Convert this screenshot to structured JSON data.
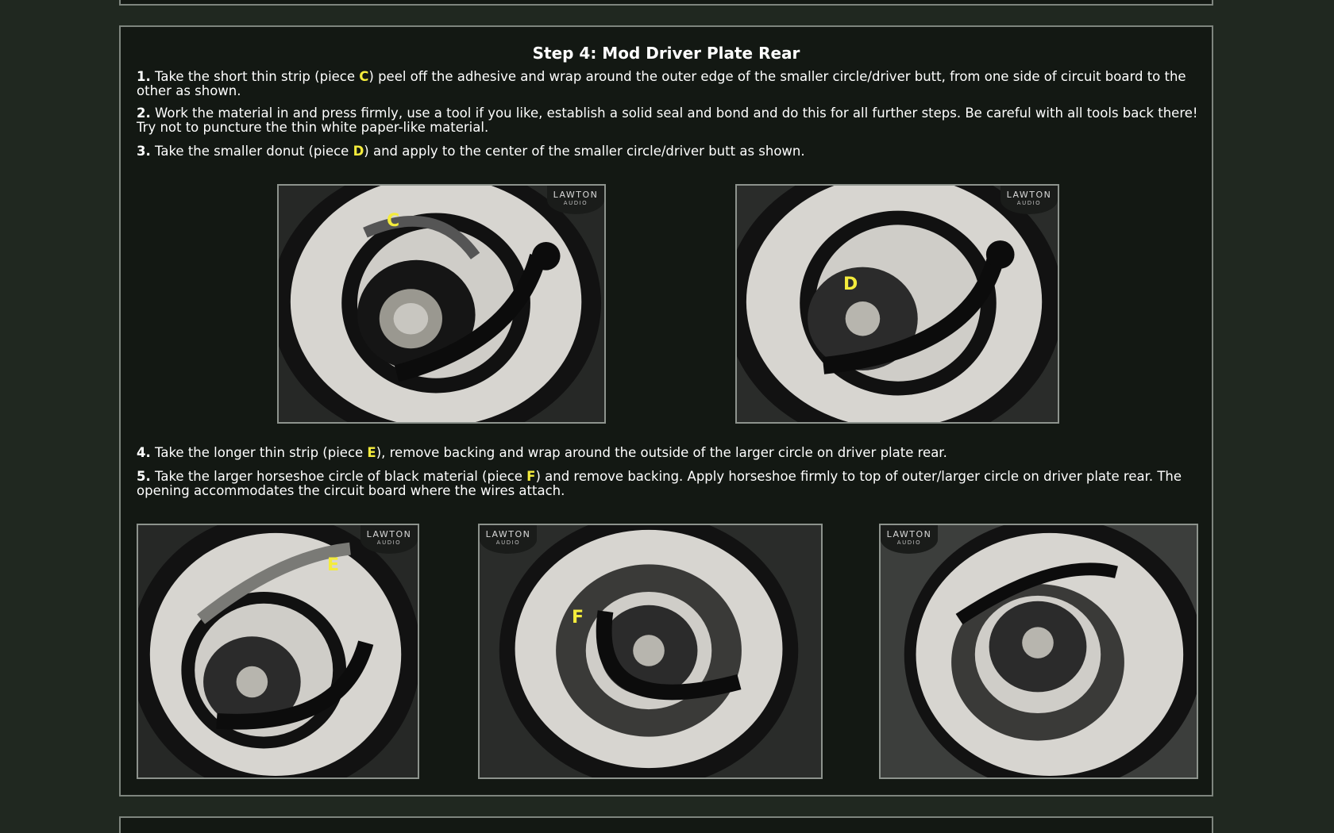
{
  "step": {
    "title": "Step 4: Mod Driver Plate Rear"
  },
  "instructions": [
    {
      "number": "1.",
      "before": " Take the short thin strip (piece ",
      "piece": "C",
      "after": ") peel off the adhesive and wrap around the outer edge of the smaller circle/driver butt, from one side of circuit board to the other as shown."
    },
    {
      "number": "2.",
      "text": " Work the material in and press firmly, use a tool if you like, establish a solid seal and bond and do this for all further steps. Be careful with all tools back there! Try not to puncture the thin white paper-like material."
    },
    {
      "number": "3.",
      "before": " Take the smaller donut (piece ",
      "piece": "D",
      "after": ") and apply to the center of the smaller circle/driver butt as shown."
    },
    {
      "number": "4.",
      "before": " Take the longer thin strip (piece ",
      "piece": "E",
      "after": "), remove backing and wrap around the outside of the larger circle on driver plate rear."
    },
    {
      "number": "5.",
      "before": " Take the larger horseshoe circle of black material (piece ",
      "piece": "F",
      "after": ") and remove backing. Apply horseshoe firmly to top of outer/larger circle on driver plate rear. The opening accommodates the circuit board where the wires attach."
    }
  ],
  "logo": {
    "main": "LAWTON",
    "sub": "AUDIO"
  },
  "photos": [
    {
      "label": "C"
    },
    {
      "label": "D"
    },
    {
      "label": "E"
    },
    {
      "label": "F"
    },
    {
      "label": ""
    }
  ],
  "colors": {
    "background": "#202820",
    "panel": "#131813",
    "border": "#7e857e",
    "piece_highlight": "#f4ec3c"
  }
}
